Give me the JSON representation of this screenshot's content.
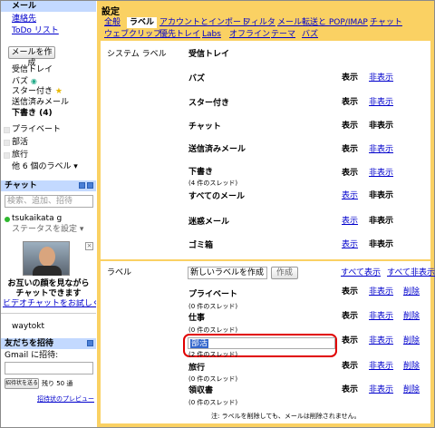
{
  "nav": {
    "mail": "メール",
    "contacts": "連絡先",
    "todo": "ToDo リスト",
    "compose": "メールを作成",
    "inbox": "受信トレイ",
    "buzz": "バズ",
    "starred": "スター付き",
    "sent": "送信済みメール",
    "drafts": "下書き (4)",
    "labels": [
      "プライベート",
      "部活",
      "旅行"
    ],
    "more_labels": "他 6 個のラベル ▾"
  },
  "chat": {
    "header": "チャット",
    "search_placeholder": "検索、追加、招待",
    "user": "tsukaikata g",
    "status": "ステータスを設定",
    "promo_line1": "お互いの顔を見ながら",
    "promo_line2": "チャットできます",
    "promo_link": "ビデオチャットをお試しください",
    "contact": "waytokt"
  },
  "invite": {
    "header": "友だちを招待",
    "subtitle": "Gmail に招待:",
    "send_button": "招待状を送る",
    "remaining": "残り 50 通",
    "preview": "招待状のプレビュー"
  },
  "settings": {
    "title": "設定",
    "tabs_row1": [
      "全般",
      "ラベル",
      "アカウントとインポート",
      "フィルタ",
      "メール転送と POP/IMAP",
      "チャット"
    ],
    "tabs_row2": [
      "ウェブクリップ",
      "優先トレイ",
      "Labs",
      "オフライン",
      "テーマ",
      "バズ"
    ],
    "system_label_header": "システム ラベル",
    "labels_header": "ラベル",
    "show": "表示",
    "hide": "非表示",
    "delete": "削除",
    "system_labels": [
      {
        "name": "受信トレイ"
      },
      {
        "name": "バズ"
      },
      {
        "name": "スター付き"
      },
      {
        "name": "チャット"
      },
      {
        "name": "送信済みメール"
      },
      {
        "name": "下書き",
        "sub": "(4 件のスレッド)"
      },
      {
        "name": "すべてのメール"
      },
      {
        "name": "迷惑メール"
      },
      {
        "name": "ゴミ箱"
      }
    ],
    "new_label_value": "新しいラベルを作成",
    "create_button": "作成",
    "show_all": "すべて表示",
    "hide_all": "すべて非表示",
    "user_labels": [
      {
        "name": "プライベート",
        "sub": "(0 件のスレッド)"
      },
      {
        "name": "仕事",
        "sub": "(0 件のスレッド)"
      },
      {
        "name": "部活",
        "sub": "(2 件のスレッド)"
      },
      {
        "name": "旅行",
        "sub": "(0 件のスレッド)"
      },
      {
        "name": "領収書",
        "sub": "(0 件のスレッド)"
      }
    ],
    "note": "注: ラベルを削除しても、メールは削除されません。"
  },
  "colors": {
    "accent": "#fad163",
    "selected": "#c3d9ff",
    "link": "#0000cc",
    "highlight": "#e10000"
  }
}
